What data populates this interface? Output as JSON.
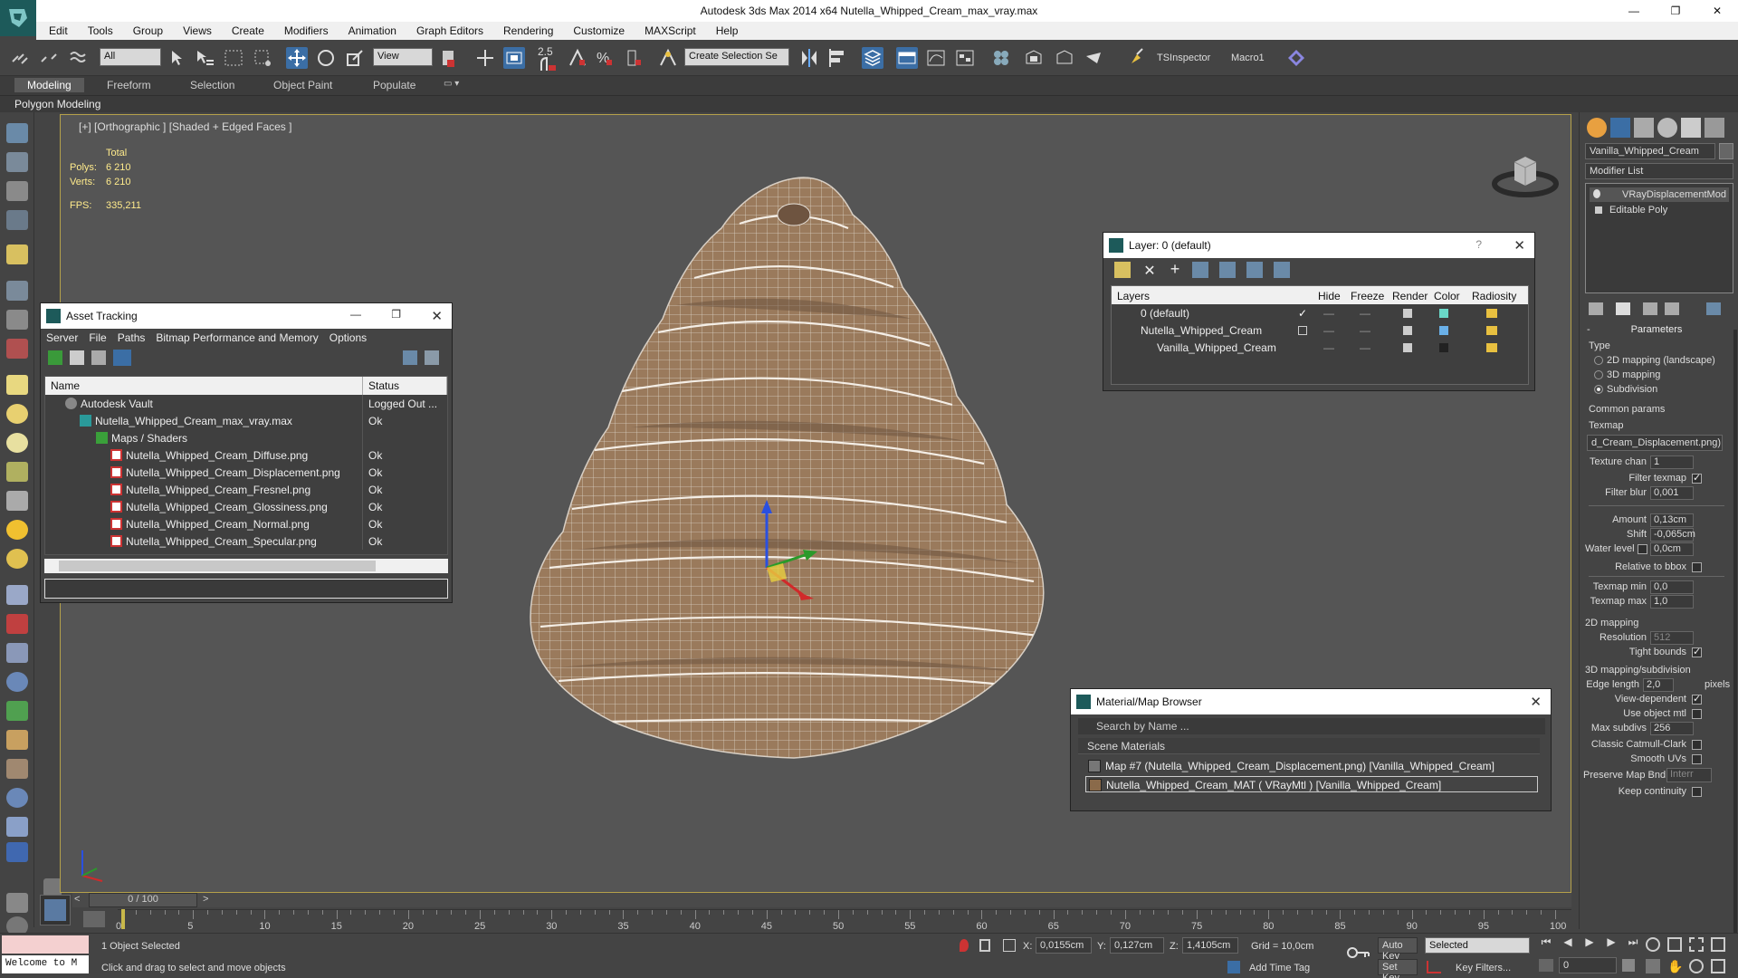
{
  "titlebar": {
    "title": "Autodesk 3ds Max  2014 x64     Nutella_Whipped_Cream_max_vray.max",
    "minimize": "—",
    "maximize": "❐",
    "close": "✕"
  },
  "menubar": {
    "items": [
      "Edit",
      "Tools",
      "Group",
      "Views",
      "Create",
      "Modifiers",
      "Animation",
      "Graph Editors",
      "Rendering",
      "Customize",
      "MAXScript",
      "Help"
    ]
  },
  "toolbar": {
    "selection_filter": "All",
    "ref_coord": "View",
    "snap_value": "2.5",
    "named_selection": "Create Selection Se",
    "tsinspector": "TSInspector",
    "macro": "Macro1"
  },
  "ribbon": {
    "tabs": [
      "Modeling",
      "Freeform",
      "Selection",
      "Object Paint",
      "Populate"
    ],
    "active_tab": "Modeling",
    "sub_label": "Polygon Modeling"
  },
  "viewport": {
    "label": "[+] [Orthographic ] [Shaded + Edged Faces ]",
    "stats": {
      "total_label": "Total",
      "polys_label": "Polys:",
      "polys_value": "6 210",
      "verts_label": "Verts:",
      "verts_value": "6 210",
      "fps_label": "FPS:",
      "fps_value": "335,211"
    }
  },
  "asset_tracking": {
    "title": "Asset Tracking",
    "menu": [
      "Server",
      "File",
      "Paths",
      "Bitmap Performance and Memory",
      "Options"
    ],
    "columns": [
      "Name",
      "Status"
    ],
    "rows": [
      {
        "name": "Autodesk Vault",
        "status": "Logged Out ..."
      },
      {
        "name": "Nutella_Whipped_Cream_max_vray.max",
        "status": "Ok"
      },
      {
        "name": "Maps / Shaders",
        "status": ""
      },
      {
        "name": "Nutella_Whipped_Cream_Diffuse.png",
        "status": "Ok"
      },
      {
        "name": "Nutella_Whipped_Cream_Displacement.png",
        "status": "Ok"
      },
      {
        "name": "Nutella_Whipped_Cream_Fresnel.png",
        "status": "Ok"
      },
      {
        "name": "Nutella_Whipped_Cream_Glossiness.png",
        "status": "Ok"
      },
      {
        "name": "Nutella_Whipped_Cream_Normal.png",
        "status": "Ok"
      },
      {
        "name": "Nutella_Whipped_Cream_Specular.png",
        "status": "Ok"
      }
    ]
  },
  "layer_window": {
    "title": "Layer: 0 (default)",
    "help": "?",
    "columns": [
      "Layers",
      "Hide",
      "Freeze",
      "Render",
      "Color",
      "Radiosity"
    ],
    "rows": [
      {
        "name": "0 (default)"
      },
      {
        "name": "Nutella_Whipped_Cream"
      },
      {
        "name": "Vanilla_Whipped_Cream"
      }
    ]
  },
  "material_browser": {
    "title": "Material/Map Browser",
    "search_placeholder": "Search by Name ...",
    "section": "Scene Materials",
    "items": [
      "Map #7 (Nutella_Whipped_Cream_Displacement.png) [Vanilla_Whipped_Cream]",
      "Nutella_Whipped_Cream_MAT ( VRayMtl ) [Vanilla_Whipped_Cream]"
    ]
  },
  "command_panel": {
    "object_name": "Vanilla_Whipped_Cream",
    "modifier_list": "Modifier List",
    "stack": [
      "VRayDisplacementMod",
      "Editable Poly"
    ],
    "rollout_title": "Parameters",
    "type_label": "Type",
    "type_options": [
      "2D mapping (landscape)",
      "3D mapping",
      "Subdivision"
    ],
    "selected_type": "Subdivision",
    "common_params": "Common params",
    "texmap_label": "Texmap",
    "texmap_value": "d_Cream_Displacement.png)",
    "texture_chan_label": "Texture chan",
    "texture_chan_value": "1",
    "filter_texmap_label": "Filter texmap",
    "filter_blur_label": "Filter blur",
    "filter_blur_value": "0,001",
    "amount_label": "Amount",
    "amount_value": "0,13cm",
    "shift_label": "Shift",
    "shift_value": "-0,065cm",
    "water_level_label": "Water level",
    "water_level_value": "0,0cm",
    "relative_bbox_label": "Relative to bbox",
    "texmap_min_label": "Texmap min",
    "texmap_min_value": "0,0",
    "texmap_max_label": "Texmap max",
    "texmap_max_value": "1,0",
    "mapping_2d": "2D mapping",
    "resolution_label": "Resolution",
    "resolution_value": "512",
    "tight_bounds_label": "Tight bounds",
    "mapping_3d": "3D mapping/subdivision",
    "edge_length_label": "Edge length",
    "edge_length_value": "2,0",
    "edge_length_unit": "pixels",
    "view_dependent_label": "View-dependent",
    "use_object_mtl_label": "Use object mtl",
    "max_subdivs_label": "Max subdivs",
    "max_subdivs_value": "256",
    "catmull_label": "Classic Catmull-Clark",
    "smooth_uvs_label": "Smooth UVs",
    "preserve_label": "Preserve Map Bnd",
    "preserve_value": "Interr",
    "keep_continuity_label": "Keep continuity"
  },
  "timeline": {
    "frame_display": "0 / 100",
    "ticks": [
      0,
      5,
      10,
      15,
      20,
      25,
      30,
      35,
      40,
      45,
      50,
      55,
      60,
      65,
      70,
      75,
      80,
      85,
      90,
      95,
      100
    ]
  },
  "statusbar": {
    "maxscript_text": "Welcome to M",
    "selection_status": "1 Object Selected",
    "prompt": "Click and drag to select and move objects",
    "x_label": "X:",
    "x_value": "0,0155cm",
    "y_label": "Y:",
    "y_value": "0,127cm",
    "z_label": "Z:",
    "z_value": "1,4105cm",
    "grid": "Grid = 10,0cm",
    "add_time_tag": "Add Time Tag",
    "auto_key": "Auto Key",
    "set_key": "Set Key",
    "selected": "Selected",
    "key_filters": "Key Filters...",
    "frame": "0"
  },
  "colors": {
    "mesh_fill": "#9a7a5c",
    "viewport_bg": "#555555",
    "viewport_border": "#b5a14a",
    "stats_text": "#ffeb8c",
    "app_logo": "#1d5a5a"
  }
}
